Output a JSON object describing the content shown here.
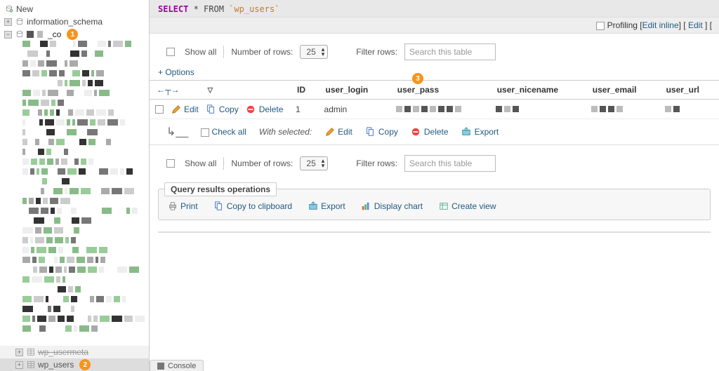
{
  "sidebar": {
    "new": "New",
    "info_schema": "information_schema",
    "db_partial": "_co",
    "wp_usermeta": "wp_usermeta",
    "wp_users": "wp_users"
  },
  "sql": {
    "select": "SELECT",
    "mid": " * FROM ",
    "table": "`wp_users`"
  },
  "topright": {
    "profiling": "Profiling",
    "edit_inline": "Edit inline",
    "edit": "Edit"
  },
  "pager": {
    "show_all": "Show all",
    "num_rows_label": "Number of rows:",
    "num_rows_value": "25",
    "filter_label": "Filter rows:",
    "filter_placeholder": "Search this table"
  },
  "options": "+ Options",
  "headers": {
    "id": "ID",
    "user_login": "user_login",
    "user_pass": "user_pass",
    "user_nicename": "user_nicename",
    "user_email": "user_email",
    "user_url": "user_url"
  },
  "row": {
    "edit": "Edit",
    "copy": "Copy",
    "delete": "Delete",
    "id_val": "1",
    "login_val": "admin"
  },
  "withsel": {
    "check_all": "Check all",
    "label": "With selected:",
    "edit": "Edit",
    "copy": "Copy",
    "delete": "Delete",
    "export": "Export"
  },
  "ops": {
    "legend": "Query results operations",
    "print": "Print",
    "copy_clip": "Copy to clipboard",
    "export": "Export",
    "chart": "Display chart",
    "create_view": "Create view"
  },
  "console": "Console",
  "badges": {
    "one": "1",
    "two": "2",
    "three": "3"
  }
}
